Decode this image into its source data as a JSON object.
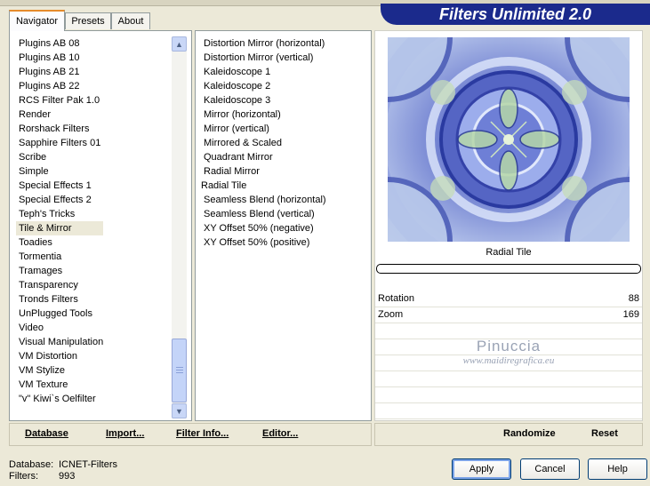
{
  "header": {
    "title": "Filters Unlimited 2.0"
  },
  "tabs": [
    {
      "label": "Navigator",
      "active": true
    },
    {
      "label": "Presets",
      "active": false
    },
    {
      "label": "About",
      "active": false
    }
  ],
  "categories": [
    "Plugins AB 08",
    "Plugins AB 10",
    "Plugins AB 21",
    "Plugins AB 22",
    "RCS Filter Pak 1.0",
    "Render",
    "Rorshack Filters",
    "Sapphire Filters 01",
    "Scribe",
    "Simple",
    "Special Effects 1",
    "Special Effects 2",
    "Teph's Tricks",
    "Tile & Mirror",
    "Toadies",
    "Tormentia",
    "Tramages",
    "Transparency",
    "Tronds Filters",
    "UnPlugged Tools",
    "Video",
    "Visual Manipulation",
    "VM Distortion",
    "VM Stylize",
    "VM Texture",
    "\"v\" Kiwi`s Oelfilter"
  ],
  "selected_category": "Tile & Mirror",
  "filters": [
    "Distortion Mirror (horizontal)",
    "Distortion Mirror (vertical)",
    "Kaleidoscope 1",
    "Kaleidoscope 2",
    "Kaleidoscope 3",
    "Mirror (horizontal)",
    "Mirror (vertical)",
    "Mirrored & Scaled",
    "Quadrant Mirror",
    "Radial Mirror",
    "Radial Tile",
    "Seamless Blend (horizontal)",
    "Seamless Blend (vertical)",
    "XY Offset 50% (negative)",
    "XY Offset 50% (positive)"
  ],
  "selected_filter": "Radial Tile",
  "preview": {
    "filter_name": "Radial Tile"
  },
  "params": [
    {
      "label": "Rotation",
      "value": "88"
    },
    {
      "label": "Zoom",
      "value": "169"
    }
  ],
  "watermark": {
    "name": "Pinuccia",
    "site": "www.maidiregrafica.eu"
  },
  "links": {
    "database": "Database",
    "import": "Import...",
    "filter_info": "Filter Info...",
    "editor": "Editor...",
    "randomize": "Randomize",
    "reset": "Reset"
  },
  "status": {
    "database_label": "Database:",
    "database_value": "ICNET-Filters",
    "filters_label": "Filters:",
    "filters_value": "993"
  },
  "buttons": {
    "apply": "Apply",
    "cancel": "Cancel",
    "help": "Help"
  },
  "colors": {
    "banner": "#1b2a8c",
    "selection": "#316ac5",
    "tab_highlight": "#e68b2c"
  }
}
